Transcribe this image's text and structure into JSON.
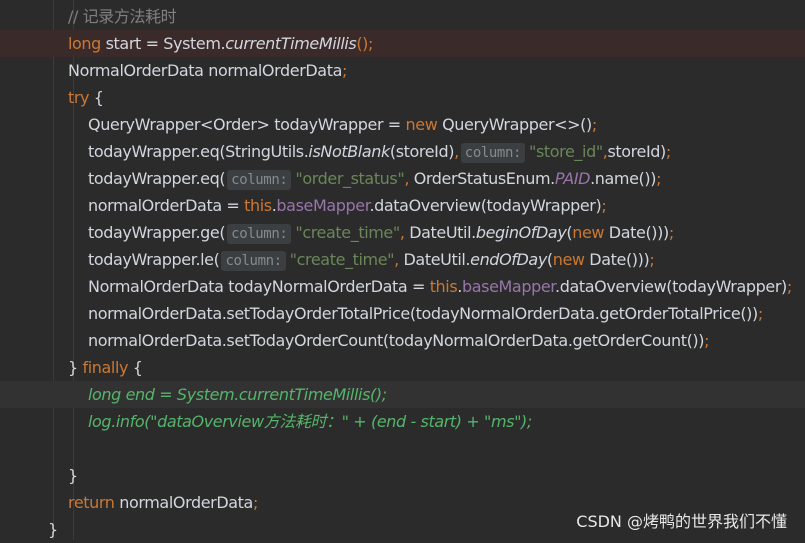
{
  "code": {
    "lines": [
      {
        "highlight": "",
        "tokens": [
          {
            "t": "// 记录方法耗时",
            "c": "cmt"
          }
        ]
      },
      {
        "highlight": "err",
        "tokens": [
          {
            "t": "long",
            "c": "kw"
          },
          {
            "t": " start = System."
          },
          {
            "t": "currentTimeMillis",
            "c": "it"
          },
          {
            "t": "();",
            "c": "kw"
          }
        ]
      },
      {
        "highlight": "",
        "tokens": [
          {
            "t": "NormalOrderData normalOrderData"
          },
          {
            "t": ";",
            "c": "kw"
          }
        ]
      },
      {
        "highlight": "",
        "tokens": [
          {
            "t": "try",
            "c": "kw"
          },
          {
            "t": " {"
          }
        ]
      },
      {
        "highlight": "",
        "tokens": [
          {
            "t": "QueryWrapper<Order> todayWrapper = "
          },
          {
            "t": "new",
            "c": "kw"
          },
          {
            "t": " QueryWrapper<>()"
          },
          {
            "t": ";",
            "c": "kw"
          }
        ]
      },
      {
        "highlight": "",
        "tokens": [
          {
            "t": "todayWrapper.eq(StringUtils."
          },
          {
            "t": "isNotBlank",
            "c": "it"
          },
          {
            "t": "(storeId)"
          },
          {
            "t": ",",
            "c": "kw"
          },
          {
            "hint": "column:"
          },
          {
            "t": "\"store_id\"",
            "c": "str"
          },
          {
            "t": ",",
            "c": "kw"
          },
          {
            "t": "storeId)"
          },
          {
            "t": ";",
            "c": "kw"
          }
        ]
      },
      {
        "highlight": "",
        "tokens": [
          {
            "t": "todayWrapper.eq("
          },
          {
            "hint": "column:"
          },
          {
            "t": "\"order_status\"",
            "c": "str"
          },
          {
            "t": ",",
            "c": "kw"
          },
          {
            "t": " OrderStatusEnum."
          },
          {
            "t": "PAID",
            "c": "fi it"
          },
          {
            "t": ".name())"
          },
          {
            "t": ";",
            "c": "kw"
          }
        ]
      },
      {
        "highlight": "",
        "tokens": [
          {
            "t": "normalOrderData = "
          },
          {
            "t": "this",
            "c": "kw"
          },
          {
            "t": "."
          },
          {
            "t": "baseMapper",
            "c": "fi"
          },
          {
            "t": ".dataOverview(todayWrapper)"
          },
          {
            "t": ";",
            "c": "kw"
          }
        ]
      },
      {
        "highlight": "",
        "tokens": [
          {
            "t": "todayWrapper.ge("
          },
          {
            "hint": "column:"
          },
          {
            "t": "\"create_time\"",
            "c": "str"
          },
          {
            "t": ",",
            "c": "kw"
          },
          {
            "t": " DateUtil."
          },
          {
            "t": "beginOfDay",
            "c": "it"
          },
          {
            "t": "("
          },
          {
            "t": "new",
            "c": "kw"
          },
          {
            "t": " Date()))"
          },
          {
            "t": ";",
            "c": "kw"
          }
        ]
      },
      {
        "highlight": "",
        "tokens": [
          {
            "t": "todayWrapper.le("
          },
          {
            "hint": "column:"
          },
          {
            "t": "\"create_time\"",
            "c": "str"
          },
          {
            "t": ",",
            "c": "kw"
          },
          {
            "t": " DateUtil."
          },
          {
            "t": "endOfDay",
            "c": "it"
          },
          {
            "t": "("
          },
          {
            "t": "new",
            "c": "kw"
          },
          {
            "t": " Date()))"
          },
          {
            "t": ";",
            "c": "kw"
          }
        ]
      },
      {
        "highlight": "",
        "tokens": [
          {
            "t": "NormalOrderData todayNormalOrderData = "
          },
          {
            "t": "this",
            "c": "kw"
          },
          {
            "t": "."
          },
          {
            "t": "baseMapper",
            "c": "fi"
          },
          {
            "t": ".dataOverview(todayWrapper)"
          },
          {
            "t": ";",
            "c": "kw"
          }
        ]
      },
      {
        "highlight": "",
        "tokens": [
          {
            "t": "normalOrderData.setTodayOrderTotalPrice(todayNormalOrderData.getOrderTotalPrice())"
          },
          {
            "t": ";",
            "c": "kw"
          }
        ]
      },
      {
        "highlight": "",
        "tokens": [
          {
            "t": "normalOrderData.setTodayOrderCount(todayNormalOrderData.getOrderCount())"
          },
          {
            "t": ";",
            "c": "kw"
          }
        ]
      },
      {
        "highlight": "",
        "tokens": [
          {
            "t": "} "
          },
          {
            "t": "finally",
            "c": "kw"
          },
          {
            "t": " {"
          }
        ]
      },
      {
        "highlight": "cur",
        "tokens": [
          {
            "t": "long end = System.currentTimeMillis();",
            "c": "green"
          }
        ]
      },
      {
        "highlight": "",
        "tokens": [
          {
            "t": "log.info(\"dataOverview方法耗时：\" + (end - start) + \"ms\");",
            "c": "green"
          }
        ]
      },
      {
        "highlight": "",
        "tokens": []
      },
      {
        "highlight": "",
        "tokens": [
          {
            "t": "}"
          }
        ]
      },
      {
        "highlight": "",
        "tokens": [
          {
            "t": "return",
            "c": "kw"
          },
          {
            "t": " normalOrderData"
          },
          {
            "t": ";",
            "c": "kw"
          }
        ]
      },
      {
        "highlight": "",
        "tokens": [
          {
            "t": "}"
          }
        ]
      }
    ]
  },
  "watermark": "CSDN @烤鸭的世界我们不懂",
  "colors": {
    "background": "#2b2b2b",
    "keyword": "#cc7832",
    "identifier": "#d2d6de",
    "field": "#9876aa",
    "string": "#6a8759",
    "comment": "#808080",
    "inactive_code": "#55b56a"
  }
}
